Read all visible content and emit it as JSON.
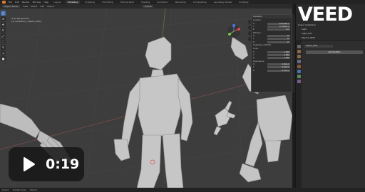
{
  "app": {
    "menu": [
      "File",
      "Edit",
      "Render",
      "Window",
      "Help"
    ],
    "workspace_tabs": [
      "Layout",
      "Modeling",
      "Sculpting",
      "UV Editing",
      "Texture Paint",
      "Shading",
      "Animation",
      "Rendering",
      "Compositing",
      "Geometry Nodes",
      "Scripting"
    ],
    "active_tab": "Modeling"
  },
  "viewport_header": {
    "mode": "Object Mode",
    "menus": [
      "View",
      "Select",
      "Add",
      "Object"
    ],
    "orientation": "Global"
  },
  "viewport": {
    "view_name": "User Perspective",
    "collection_info": "(1) Collection | Object_1693"
  },
  "npanel": {
    "title": "Transform",
    "location_label": "Location:",
    "location": [
      "-0.51693 m",
      "0.14201 m",
      "0 m"
    ],
    "rotation_label": "Rotation:",
    "rotation": [
      "0°",
      "0°",
      "0°"
    ],
    "mode_label": "Quaternion (WXYZ)",
    "scale_label": "Scale:",
    "scale": [
      "1.000",
      "1.000",
      "1.000"
    ],
    "dimensions_label": "Dimensions:",
    "dimensions": [
      "0.254 m",
      "0.214 m",
      "0.223 m"
    ],
    "axes": [
      "X",
      "Y",
      "Z"
    ]
  },
  "outliner": {
    "scene": "Scene",
    "view_layer": "ViewLayer",
    "items": [
      "Scene Collection",
      "Light",
      "Light_001",
      "Object_1693"
    ]
  },
  "properties": {
    "object_name": "Object_1693",
    "add_modifier": "Add Modifier"
  },
  "statusbar": {
    "items": [
      "Select",
      "Rotate View",
      "Object"
    ]
  },
  "watermark": {
    "text": "VEED"
  },
  "video": {
    "time": "0:19"
  },
  "colors": {
    "accent": "#4672b0",
    "mesh": "#c8c8c8",
    "viewport_bg": "#3d3d3d"
  }
}
